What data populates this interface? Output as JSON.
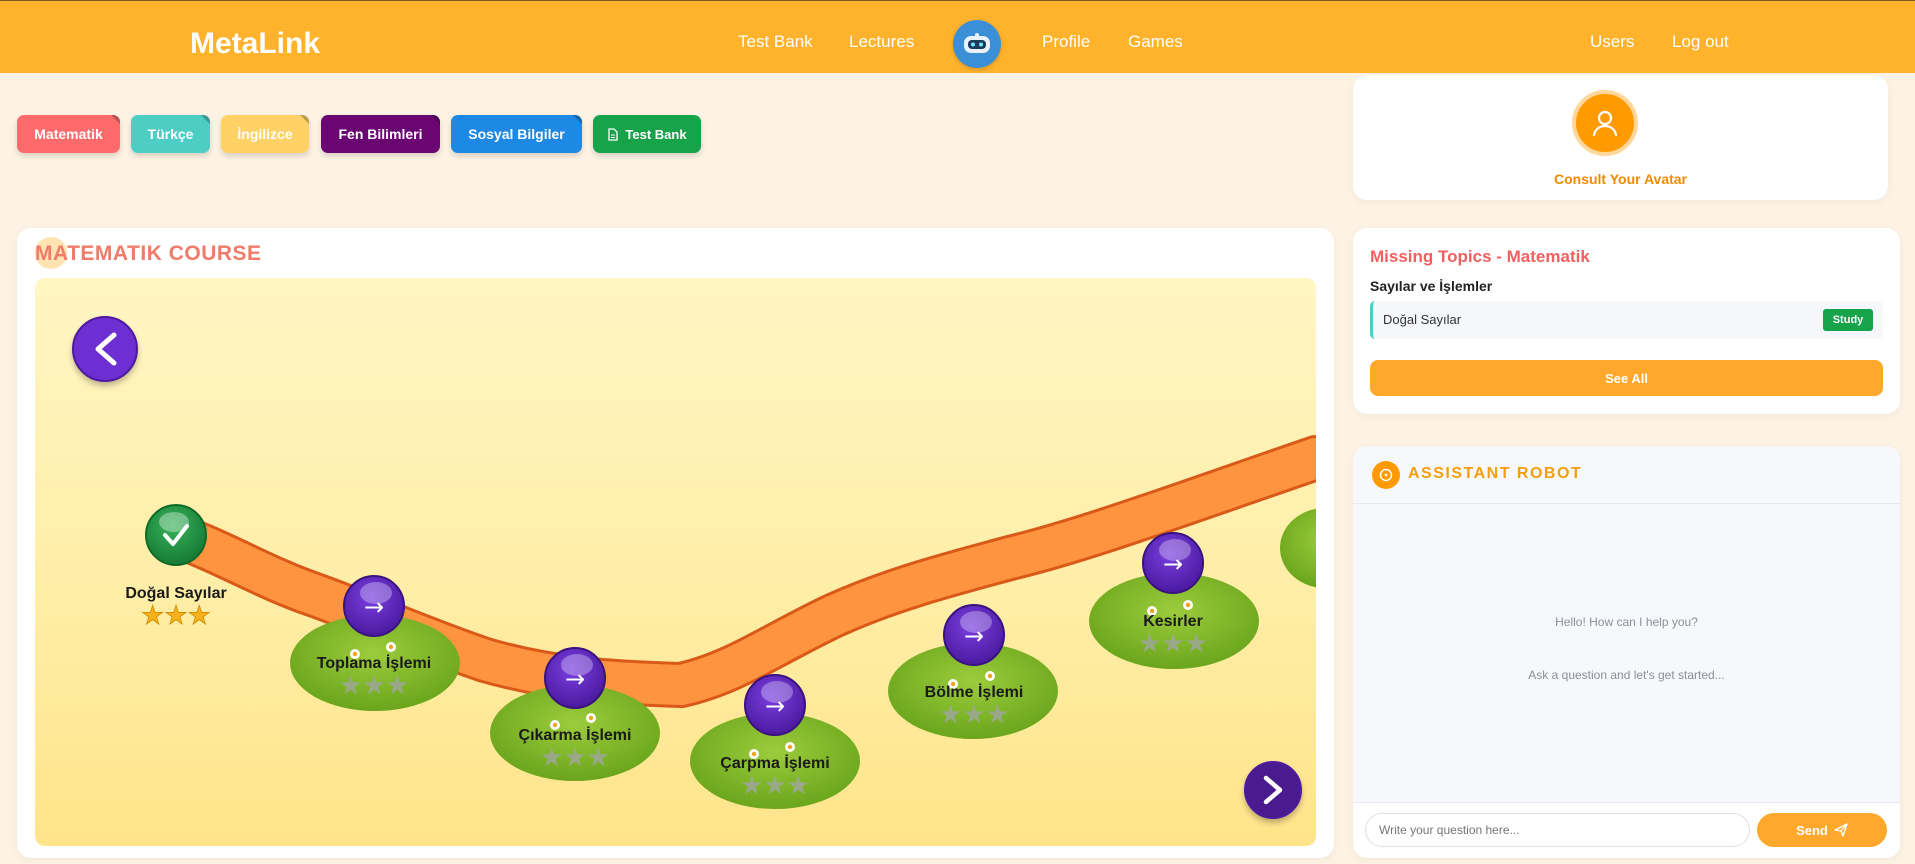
{
  "header": {
    "logo": "MetaLink",
    "nav": {
      "test_bank": "Test Bank",
      "lectures": "Lectures",
      "profile": "Profile",
      "games": "Games",
      "users": "Users",
      "logout": "Log out"
    }
  },
  "subjects": [
    {
      "label": "Matematik",
      "color": "#ff6b6b"
    },
    {
      "label": "Türkçe",
      "color": "#4ecdc4"
    },
    {
      "label": "İngilizce",
      "color": "#ffd166"
    },
    {
      "label": "Fen Bilimleri",
      "color": "#6a0572"
    },
    {
      "label": "Sosyal Bilgiler",
      "color": "#1e88e5"
    },
    {
      "label": "Test Bank",
      "color": "#16a34a"
    }
  ],
  "avatar": {
    "label": "Consult Your Avatar"
  },
  "course": {
    "title": "MATEMATIK COURSE",
    "lessons": [
      {
        "label": "Doğal Sayılar",
        "completed": true,
        "stars_earned": 3
      },
      {
        "label": "Toplama İşlemi",
        "completed": false,
        "stars_earned": 0
      },
      {
        "label": "Çıkarma İşlemi",
        "completed": false,
        "stars_earned": 0
      },
      {
        "label": "Çarpma İşlemi",
        "completed": false,
        "stars_earned": 0
      },
      {
        "label": "Bölme İşlemi",
        "completed": false,
        "stars_earned": 0
      },
      {
        "label": "Kesirler",
        "completed": false,
        "stars_earned": 0
      }
    ]
  },
  "missing": {
    "title": "Missing Topics - Matematik",
    "subtitle": "Sayılar ve İşlemler",
    "topic": "Doğal Sayılar",
    "study_label": "Study",
    "see_all": "See All"
  },
  "assistant": {
    "title": "ASSISTANT ROBOT",
    "greeting": "Hello! How can I help you?",
    "prompt": "Ask a question and let's get started...",
    "placeholder": "Write your question here...",
    "send_label": "Send"
  },
  "colors": {
    "header": "#ffb22c",
    "accent": "#ffa82c",
    "purple": "#6d2ed2"
  }
}
